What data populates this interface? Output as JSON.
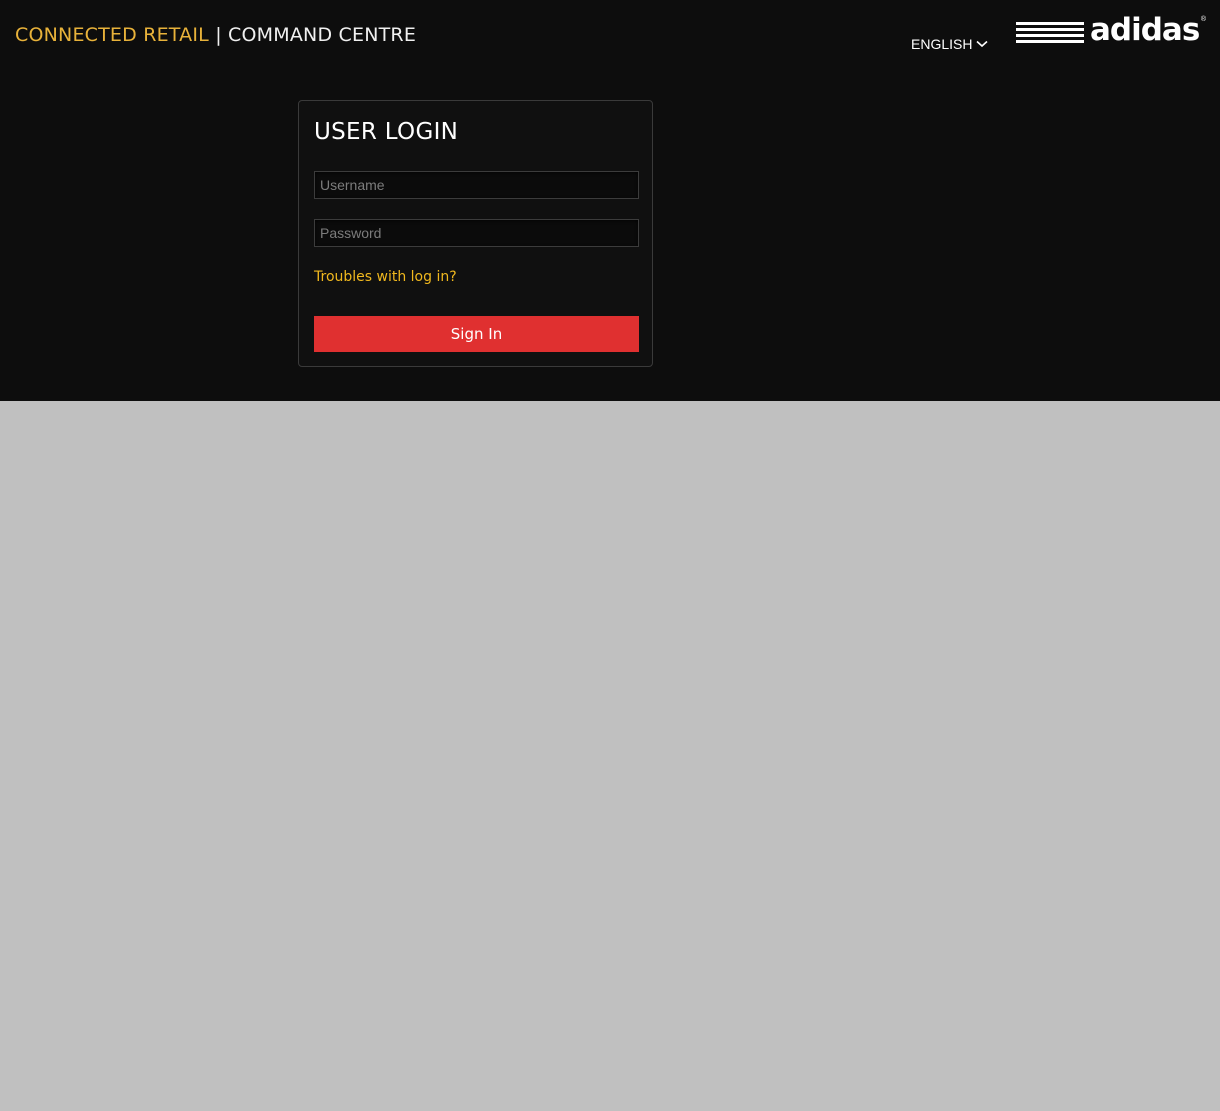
{
  "header": {
    "title_accent": "CONNECTED RETAIL",
    "title_separator": "|",
    "title_rest": "COMMAND CENTRE",
    "language": "ENGLISH",
    "logo_text": "adidas",
    "logo_reg": "®"
  },
  "login": {
    "heading": "USER LOGIN",
    "username_placeholder": "Username",
    "password_placeholder": "Password",
    "troubles_link": "Troubles with log in?",
    "signin_label": "Sign In"
  },
  "colors": {
    "accent": "#e8b23a",
    "link": "#f0b81e",
    "button": "#e03030",
    "header_bg": "#0d0d0d",
    "page_bg": "#c0c0c0"
  },
  "icons": {
    "language_dropdown": "chevron-down-icon",
    "brand": "adidas-stripes-logo"
  }
}
